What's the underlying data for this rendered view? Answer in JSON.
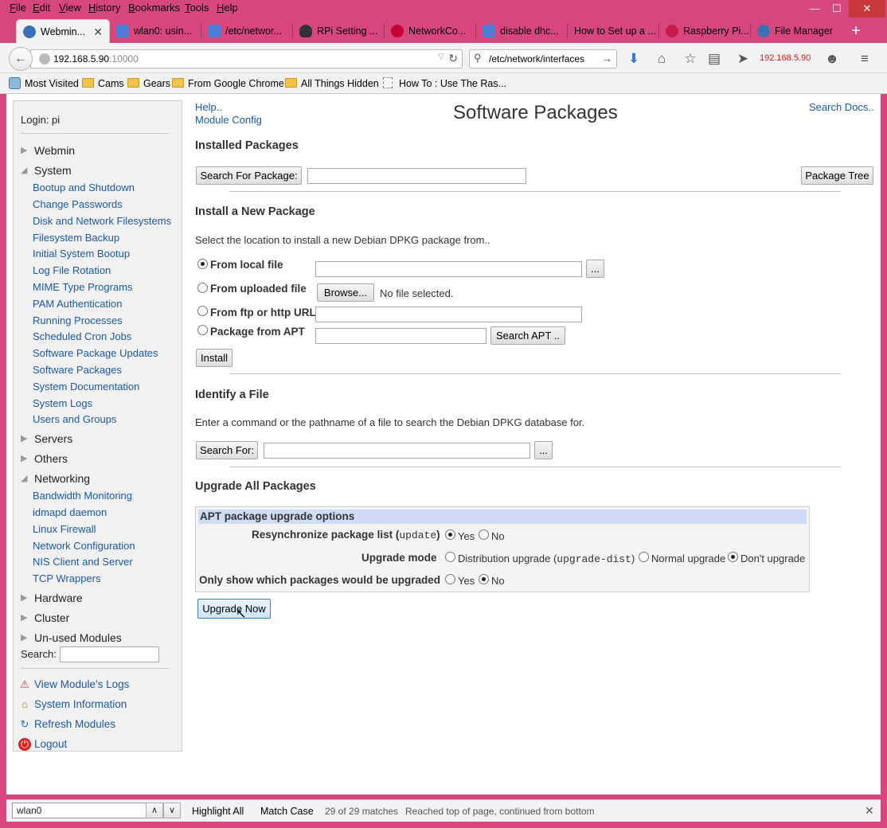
{
  "menu": [
    "File",
    "Edit",
    "View",
    "History",
    "Bookmarks",
    "Tools",
    "Help"
  ],
  "window_controls": {
    "minimize": "—",
    "maximize": "☐",
    "close": "✕"
  },
  "tabs": [
    {
      "label": "Webmin...",
      "active": true,
      "icon": "webmin-icon"
    },
    {
      "label": "wlan0: usin...",
      "icon": "google-icon"
    },
    {
      "label": "/etc/networ...",
      "icon": "google-icon"
    },
    {
      "label": "RPi Setting ...",
      "icon": "tux-icon"
    },
    {
      "label": "NetworkCo...",
      "icon": "debian-icon"
    },
    {
      "label": "disable dhc...",
      "icon": "google-icon"
    },
    {
      "label": "How to Set up a ...",
      "icon": ""
    },
    {
      "label": "Raspberry Pi...",
      "icon": "raspberry-icon"
    },
    {
      "label": "File Manager",
      "icon": "webmin-icon"
    }
  ],
  "new_tab": "+",
  "nav": {
    "url_host": "192.168.5.90",
    "url_port": ":10000",
    "search_value": "/etc/network/interfaces",
    "ip_indicator": "192.168.5.90"
  },
  "bookmarks": [
    "Most Visited",
    "Cams",
    "Gears",
    "From Google Chrome",
    "All Things Hidden",
    "How To : Use The Ras..."
  ],
  "sidebar": {
    "login": "Login: pi",
    "categories": {
      "webmin": "Webmin",
      "system": "System",
      "servers": "Servers",
      "others": "Others",
      "networking": "Networking",
      "hardware": "Hardware",
      "cluster": "Cluster",
      "unused": "Un-used Modules"
    },
    "system_items": [
      "Bootup and Shutdown",
      "Change Passwords",
      "Disk and Network Filesystems",
      "Filesystem Backup",
      "Initial System Bootup",
      "Log File Rotation",
      "MIME Type Programs",
      "PAM Authentication",
      "Running Processes",
      "Scheduled Cron Jobs",
      "Software Package Updates",
      "Software Packages",
      "System Documentation",
      "System Logs",
      "Users and Groups"
    ],
    "networking_items": [
      "Bandwidth Monitoring",
      "idmapd daemon",
      "Linux Firewall",
      "Network Configuration",
      "NIS Client and Server",
      "TCP Wrappers"
    ],
    "search_label": "Search:",
    "footer_links": [
      "View Module's Logs",
      "System Information",
      "Refresh Modules",
      "Logout"
    ]
  },
  "main": {
    "help": "Help..",
    "module_config": "Module Config",
    "title": "Software Packages",
    "search_docs": "Search Docs..",
    "installed_heading": "Installed Packages",
    "search_for_package_btn": "Search For Package:",
    "package_tree_btn": "Package Tree",
    "install_heading": "Install a New Package",
    "install_desc": "Select the location to install a new Debian DPKG package from..",
    "opt_local": "From local file",
    "opt_uploaded": "From uploaded file",
    "opt_url": "From ftp or http URL",
    "opt_apt": "Package from APT",
    "ellipsis_btn": "...",
    "browse_btn": "Browse...",
    "no_file": "No file selected.",
    "search_apt_btn": "Search APT ..",
    "install_btn": "Install",
    "identify_heading": "Identify a File",
    "identify_desc": "Enter a command or the pathname of a file to search the Debian DPKG database for.",
    "search_for_btn": "Search For:",
    "upgrade_heading": "Upgrade All Packages",
    "apt_box_title": "APT package upgrade options",
    "resync_label": "Resynchronize package list (",
    "resync_code": "update",
    "resync_close": ")",
    "yes": "Yes",
    "no": "No",
    "upgrade_mode_label": "Upgrade mode",
    "dist_upgrade": "Distribution upgrade (",
    "dist_code": "upgrade-dist",
    "dist_close": ")",
    "normal_upgrade": "Normal upgrade",
    "dont_upgrade": "Don't upgrade",
    "only_show_label": "Only show which packages would be upgraded",
    "upgrade_now_btn": "Upgrade Now"
  },
  "findbar": {
    "value": "wlan0",
    "highlight_all": "Highlight All",
    "match_case": "Match Case",
    "matches": "29 of 29 matches",
    "status": "Reached top of page, continued from bottom"
  }
}
